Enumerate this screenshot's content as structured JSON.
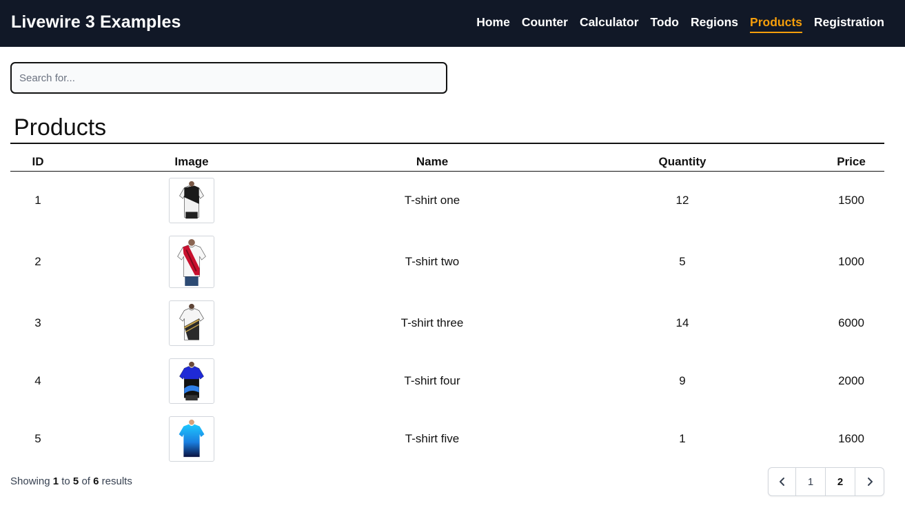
{
  "app": {
    "brand": "Livewire 3 Examples"
  },
  "nav": {
    "items": [
      {
        "label": "Home"
      },
      {
        "label": "Counter"
      },
      {
        "label": "Calculator"
      },
      {
        "label": "Todo"
      },
      {
        "label": "Regions"
      },
      {
        "label": "Products",
        "active": true
      },
      {
        "label": "Registration"
      }
    ],
    "active_color": "#f59e0b",
    "bar_color": "#111827"
  },
  "search": {
    "placeholder": "Search for...",
    "value": ""
  },
  "page": {
    "title": "Products"
  },
  "table": {
    "headers": {
      "id": "ID",
      "image": "Image",
      "name": "Name",
      "quantity": "Quantity",
      "price": "Price"
    },
    "rows": [
      {
        "id": "1",
        "image_icon": "tshirt-black-white-image",
        "name": "T-shirt one",
        "quantity": "12",
        "price": "1500"
      },
      {
        "id": "2",
        "image_icon": "tshirt-red-white-image",
        "name": "T-shirt two",
        "quantity": "5",
        "price": "1000"
      },
      {
        "id": "3",
        "image_icon": "tshirt-white-gold-image",
        "name": "T-shirt three",
        "quantity": "14",
        "price": "6000"
      },
      {
        "id": "4",
        "image_icon": "tshirt-blue-black-image",
        "name": "T-shirt four",
        "quantity": "9",
        "price": "2000"
      },
      {
        "id": "5",
        "image_icon": "tshirt-cyan-navy-image",
        "name": "T-shirt five",
        "quantity": "1",
        "price": "1600"
      }
    ]
  },
  "footer": {
    "showing_prefix": "Showing",
    "from": "1",
    "to_word": "to",
    "to": "5",
    "of_word": "of",
    "total": "6",
    "suffix": "results"
  },
  "pagination": {
    "pages": [
      "1",
      "2"
    ],
    "prev_icon": "chevron-left-icon",
    "next_icon": "chevron-right-icon"
  }
}
